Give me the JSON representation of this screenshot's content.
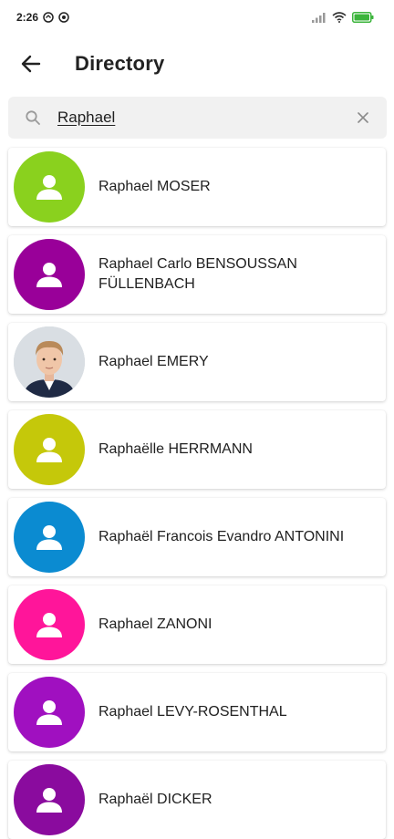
{
  "status": {
    "time": "2:26",
    "battery_color": "#3bb43b"
  },
  "header": {
    "title": "Directory",
    "back_icon": "arrow-left-icon"
  },
  "search": {
    "value": "Raphael",
    "placeholder": "",
    "icon": "search-icon",
    "clear_icon": "close-icon"
  },
  "people": [
    {
      "name": "Raphael MOSER",
      "avatar_color": "#8ad11e",
      "photo": false
    },
    {
      "name": "Raphael Carlo BENSOUSSAN FÜLLENBACH",
      "avatar_color": "#990099",
      "photo": false
    },
    {
      "name": "Raphael EMERY",
      "avatar_color": "#cfd6dc",
      "photo": true
    },
    {
      "name": "Raphaëlle HERRMANN",
      "avatar_color": "#c5c80a",
      "photo": false
    },
    {
      "name": "Raphaël Francois Evandro ANTONINI",
      "avatar_color": "#0b8bd1",
      "photo": false
    },
    {
      "name": "Raphael ZANONI",
      "avatar_color": "#ff159a",
      "photo": false
    },
    {
      "name": "Raphael LEVY-ROSENTHAL",
      "avatar_color": "#a010c0",
      "photo": false
    },
    {
      "name": "Raphaël DICKER",
      "avatar_color": "#8a0b9e",
      "photo": false
    }
  ]
}
